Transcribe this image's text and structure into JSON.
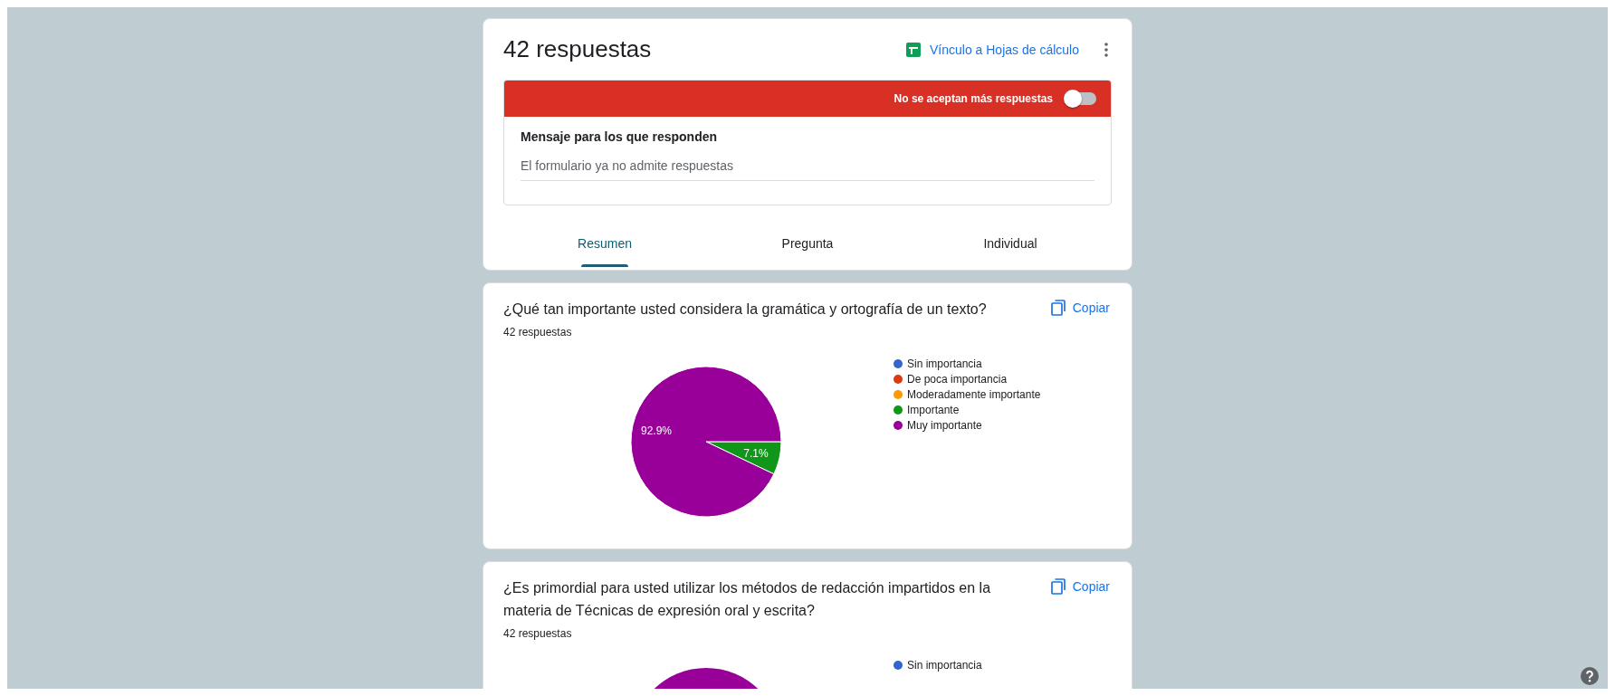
{
  "header": {
    "title": "42 respuestas",
    "sheets_link": "Vínculo a Hojas de cálculo",
    "banner": {
      "label": "No se aceptan más respuestas",
      "on": false
    },
    "message": {
      "label": "Mensaje para los que responden",
      "value": "El formulario ya no admite respuestas"
    },
    "tabs": [
      {
        "label": "Resumen",
        "selected": true
      },
      {
        "label": "Pregunta",
        "selected": false
      },
      {
        "label": "Individual",
        "selected": false
      }
    ]
  },
  "questions": [
    {
      "title": "¿Qué tan importante usted considera la gramática y ortografía de un texto?",
      "copy": "Copiar",
      "count": "42 respuestas",
      "chart_data": {
        "type": "pie",
        "categories": [
          "Sin importancia",
          "De poca importancia",
          "Moderadamente importante",
          "Importante",
          "Muy importante"
        ],
        "values": [
          0,
          0,
          0,
          7.1,
          92.9
        ],
        "value_labels": [
          null,
          null,
          null,
          "7.1%",
          "92.9%"
        ]
      },
      "legend": [
        {
          "color": "#3366cc"
        },
        {
          "color": "#dc3912"
        },
        {
          "color": "#ff9900"
        },
        {
          "color": "#109618"
        },
        {
          "color": "#990099"
        }
      ]
    },
    {
      "title": "¿Es primordial para usted utilizar los métodos de redacción impartidos en la materia de Técnicas de expresión oral y escrita?",
      "copy": "Copiar",
      "count": "42 respuestas",
      "legend": [
        {
          "label": "Sin importancia",
          "color": "#3366cc"
        }
      ]
    }
  ]
}
